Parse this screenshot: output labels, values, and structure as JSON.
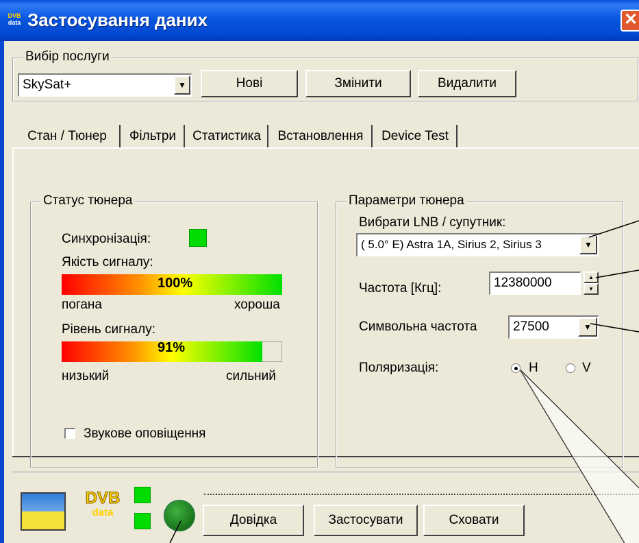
{
  "window": {
    "title": "Застосування даних",
    "close_glyph": "✕",
    "app_icon": "dvb-data-icon",
    "app_icon_text": [
      "DVB",
      "data"
    ]
  },
  "service": {
    "group_label": "Вибір послуги",
    "selected": "SkySat+",
    "new_label": "Нові",
    "change_label": "Змінити",
    "delete_label": "Видалити"
  },
  "tabs": [
    "Стан / Тюнер",
    "Фільтри",
    "Статистика",
    "Встановлення",
    "Device Test"
  ],
  "tuner_status": {
    "group_label": "Статус тюнера",
    "sync_label": "Синхронізація:",
    "quality_label": "Якість сигналу:",
    "quality_value": "100%",
    "quality_fraction": 1.0,
    "quality_low": "погана",
    "quality_high": "хороша",
    "level_label": "Рівень сигналу:",
    "level_value": "91%",
    "level_fraction": 0.91,
    "level_low": "низький",
    "level_high": "сильний",
    "sound_label": "Звукове оповіщення"
  },
  "tuner_params": {
    "group_label": "Параметри тюнера",
    "lnb_label": "Вибрати LNB / супутник:",
    "lnb_value": "(   5.0° E) Astra 1A, Sirius 2, Sirius 3",
    "freq_label": "Частота [Кгц]:",
    "freq_value": "12380000",
    "symbol_label": "Символьна частота",
    "symbol_value": "27500",
    "pol_label": "Поляризація:",
    "pol_h": "H",
    "pol_v": "V"
  },
  "bottom": {
    "logo_line1": "DVB",
    "logo_line2": "data",
    "help_label": "Довідка",
    "apply_label": "Застосувати",
    "hide_label": "Сховати"
  },
  "colors": {
    "titlebar": "#0856e0",
    "indicator": "#00dc00",
    "face": "#ece9d8"
  }
}
